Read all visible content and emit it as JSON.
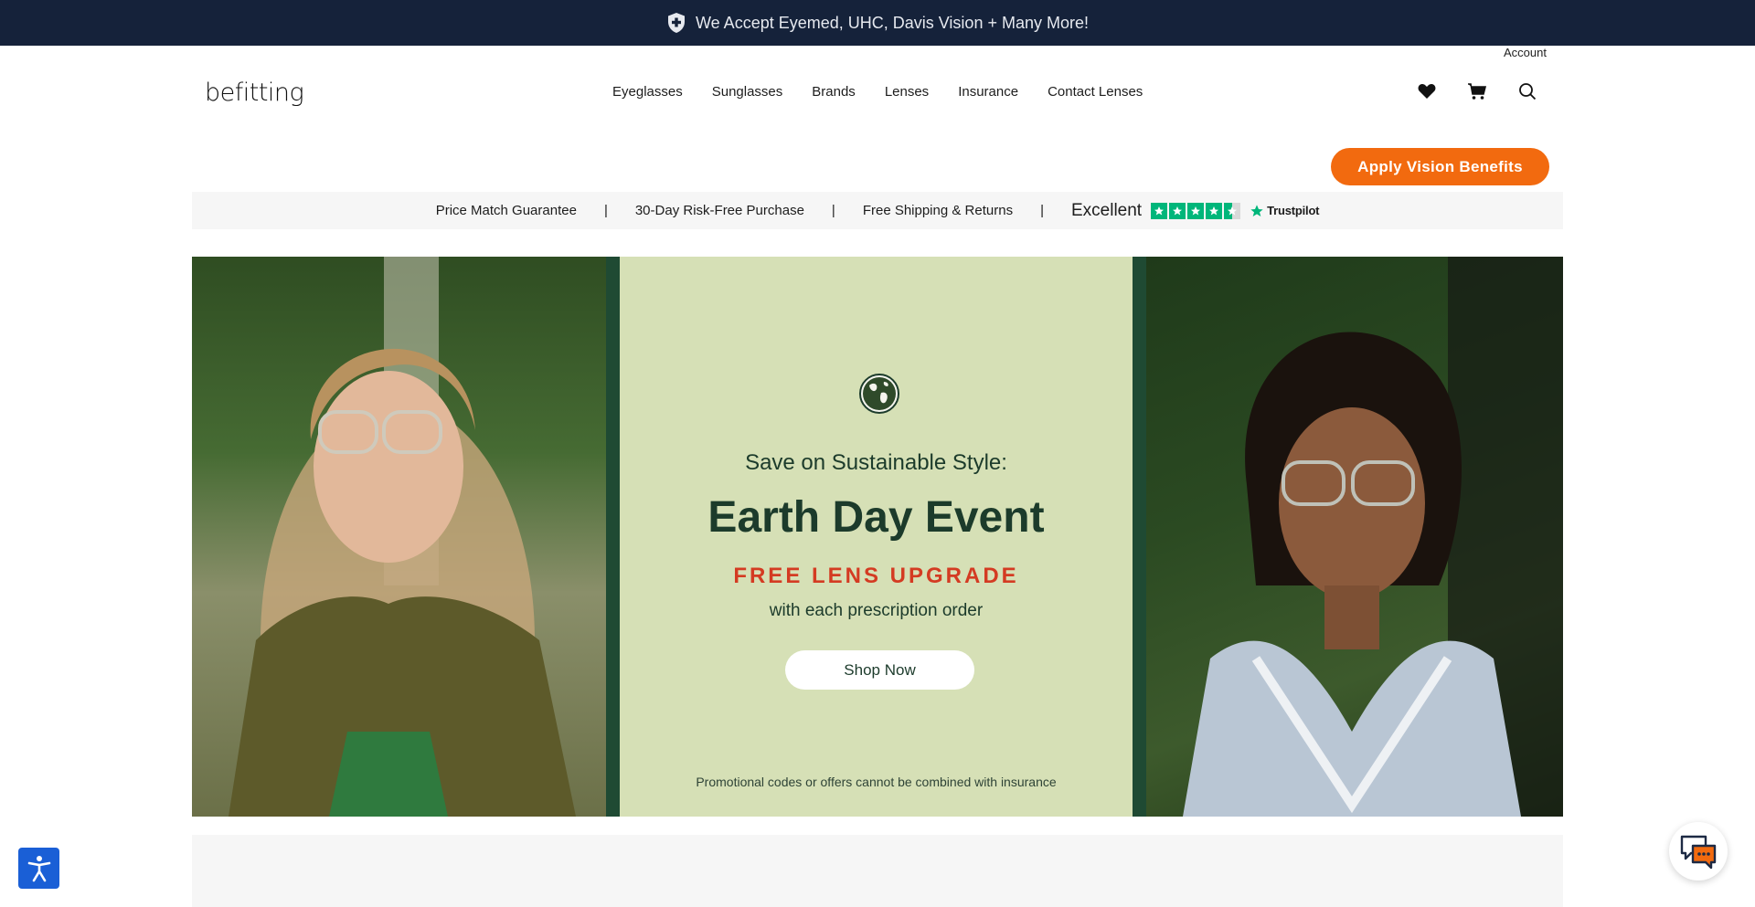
{
  "announcement": {
    "text": "We Accept Eyemed, UHC, Davis Vision + Many More!",
    "icon": "shield-plus-icon"
  },
  "header": {
    "account_label": "Account",
    "logo_text": "befitting",
    "nav": [
      {
        "label": "Eyeglasses"
      },
      {
        "label": "Sunglasses"
      },
      {
        "label": "Brands"
      },
      {
        "label": "Lenses"
      },
      {
        "label": "Insurance"
      },
      {
        "label": "Contact Lenses"
      }
    ],
    "icons": [
      "heart-icon",
      "cart-icon",
      "search-icon"
    ]
  },
  "apply_button": {
    "label": "Apply Vision Benefits",
    "color": "#f26a0f"
  },
  "trust_bar": {
    "items": [
      "Price Match Guarantee",
      "30-Day Risk-Free Purchase",
      "Free Shipping & Returns"
    ],
    "separator": "|",
    "rating_text": "Excellent",
    "stars": 4.5,
    "trustpilot_label": "Trustpilot",
    "star_color": "#00b67a"
  },
  "hero": {
    "kicker": "Save on Sustainable Style:",
    "title": "Earth Day Event",
    "promo": "FREE LENS UPGRADE",
    "promo_sub": "with each prescription order",
    "cta": "Shop Now",
    "disclaimer": "Promotional codes or offers cannot be combined with insurance",
    "panel_color": "#d6e0b6",
    "promo_color": "#d43b22",
    "icon": "globe-icon"
  },
  "widgets": {
    "accessibility_icon": "accessibility-icon",
    "chat_icon": "chat-icon"
  }
}
